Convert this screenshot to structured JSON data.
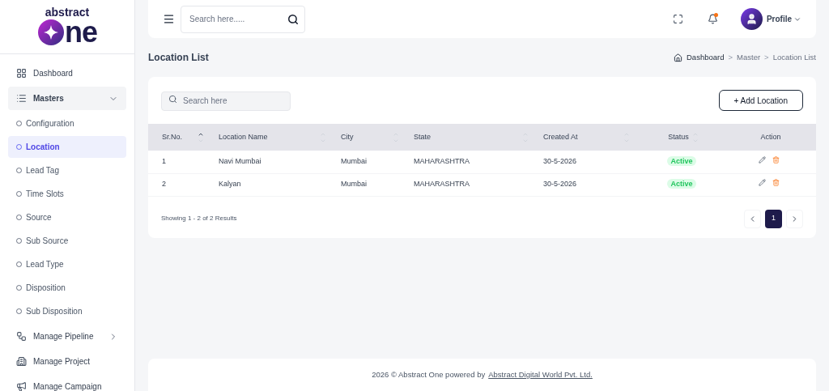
{
  "logo": {
    "top": "abstract",
    "bottom": "ne"
  },
  "sidebar": {
    "items": [
      {
        "kind": "link",
        "label": "Dashboard"
      },
      {
        "kind": "group",
        "label": "Masters",
        "expanded": true,
        "children": [
          {
            "label": "Configuration",
            "selected": false
          },
          {
            "label": "Location",
            "selected": true
          },
          {
            "label": "Lead Tag",
            "selected": false
          },
          {
            "label": "Time Slots",
            "selected": false
          },
          {
            "label": "Source",
            "selected": false
          },
          {
            "label": "Sub Source",
            "selected": false
          },
          {
            "label": "Lead Type",
            "selected": false
          },
          {
            "label": "Disposition",
            "selected": false
          },
          {
            "label": "Sub Disposition",
            "selected": false
          }
        ]
      },
      {
        "kind": "submenu",
        "label": "Manage Pipeline"
      },
      {
        "kind": "link",
        "label": "Manage Project"
      },
      {
        "kind": "link",
        "label": "Manage Campaign"
      }
    ]
  },
  "topbar": {
    "search": {
      "placeholder": "Search here....."
    },
    "profile": "Profile"
  },
  "page": {
    "title": "Location List",
    "breadcrumbs": [
      "Dashboard",
      "Master",
      "Location List"
    ],
    "separator": ">"
  },
  "card": {
    "search": {
      "placeholder": "Search here"
    },
    "add_button": "+ Add Location",
    "table": {
      "columns": [
        {
          "label": "Sr.No.",
          "sorted": true
        },
        {
          "label": "Location Name",
          "sorted": false
        },
        {
          "label": "City",
          "sorted": false
        },
        {
          "label": "State",
          "sorted": false
        },
        {
          "label": "Created At",
          "sorted": false
        },
        {
          "label": "Status",
          "sorted": false
        },
        {
          "label": "Action"
        }
      ],
      "rows": [
        {
          "sr": "1",
          "name": "Navi Mumbai",
          "city": "Mumbai",
          "state": "MAHARASHTRA",
          "created": "30-5-2026",
          "status": "Active"
        },
        {
          "sr": "2",
          "name": "Kalyan",
          "city": "Mumbai",
          "state": "MAHARASHTRA",
          "created": "30-5-2026",
          "status": "Active"
        }
      ]
    },
    "summary": "Showing 1 - 2 of 2 Results",
    "pagination": {
      "pages": [
        {
          "label": "1",
          "selected": true
        }
      ]
    }
  },
  "footer": {
    "text": "2026 © Abstract One powered by",
    "link": "Abstract Digital World Pvt. Ltd."
  }
}
